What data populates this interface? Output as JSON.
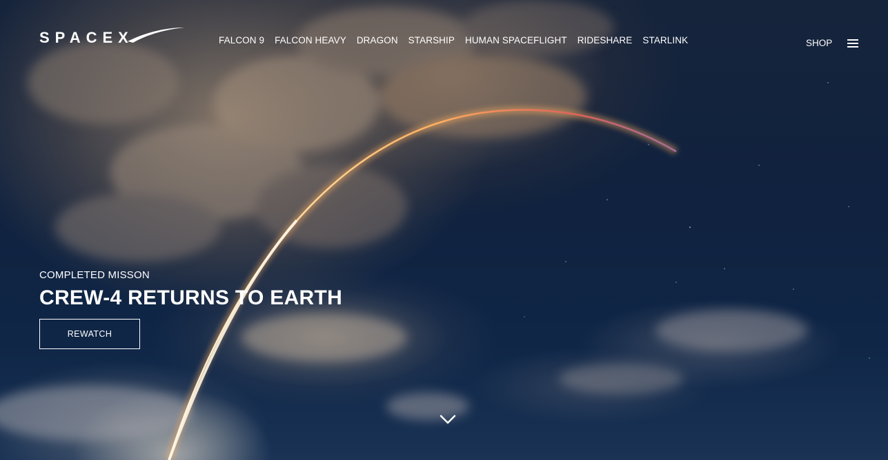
{
  "brand": {
    "logo_text": "SPACEX"
  },
  "nav": {
    "items": [
      {
        "label": "FALCON 9"
      },
      {
        "label": "FALCON HEAVY"
      },
      {
        "label": "DRAGON"
      },
      {
        "label": "STARSHIP"
      },
      {
        "label": "HUMAN SPACEFLIGHT"
      },
      {
        "label": "RIDESHARE"
      },
      {
        "label": "STARLINK"
      }
    ],
    "shop_label": "SHOP",
    "menu_icon": "hamburger-menu-icon"
  },
  "hero": {
    "kicker": "COMPLETED MISSON",
    "title": "CREW-4 RETURNS TO EARTH",
    "button_label": "REWATCH",
    "scroll_icon": "chevron-down-icon"
  },
  "colors": {
    "text": "#ffffff",
    "sky": "#10223f",
    "trail": "#ffb060"
  }
}
